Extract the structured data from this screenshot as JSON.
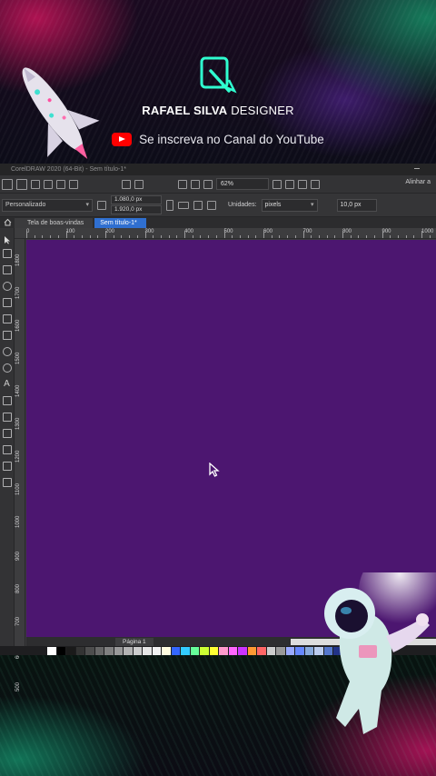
{
  "brand": {
    "name_bold": "RAFAEL SILVA",
    "name_rest": " DESIGNER",
    "subscribe": "Se inscreva no Canal do YouTube"
  },
  "app": {
    "title": "CorelDRAW 2020 (64-Bit) - Sem título-1*",
    "zoom": "62%",
    "align_label": "Alinhar a",
    "preset": "Personalizado",
    "width": "1.080,0 px",
    "height": "1.920,0 px",
    "units_label": "Unidades:",
    "units_value": "pixels",
    "nudge": "10,0 px",
    "tabs": [
      {
        "label": "Tela de boas-vindas"
      },
      {
        "label": "Sem título-1*"
      }
    ],
    "ruler_top": [
      "0",
      "100",
      "200",
      "300",
      "400",
      "500",
      "600",
      "700",
      "800",
      "900",
      "1000"
    ],
    "ruler_left": [
      "1800",
      "1700",
      "1600",
      "1500",
      "1400",
      "1300",
      "1200",
      "1100",
      "1000",
      "900",
      "800",
      "700",
      "600",
      "500"
    ],
    "page_tab": "Página 1",
    "canvas_color": "#4c1670",
    "palette": [
      "#ffffff",
      "#000000",
      "#1a1a1a",
      "#333333",
      "#4d4d4d",
      "#666666",
      "#808080",
      "#999999",
      "#b3b3b3",
      "#cccccc",
      "#e6e6e6",
      "#f2f2f2",
      "#fffde0",
      "#3366ff",
      "#33ccff",
      "#66ff99",
      "#ccff33",
      "#ffff33",
      "#ff99cc",
      "#ff66ff",
      "#cc33ff",
      "#ff9933",
      "#ff6666",
      "#cccccc",
      "#999999",
      "#99aaff",
      "#6688ff",
      "#88aadd",
      "#bbccee",
      "#5577cc",
      "#223388",
      "#1133aa"
    ]
  }
}
